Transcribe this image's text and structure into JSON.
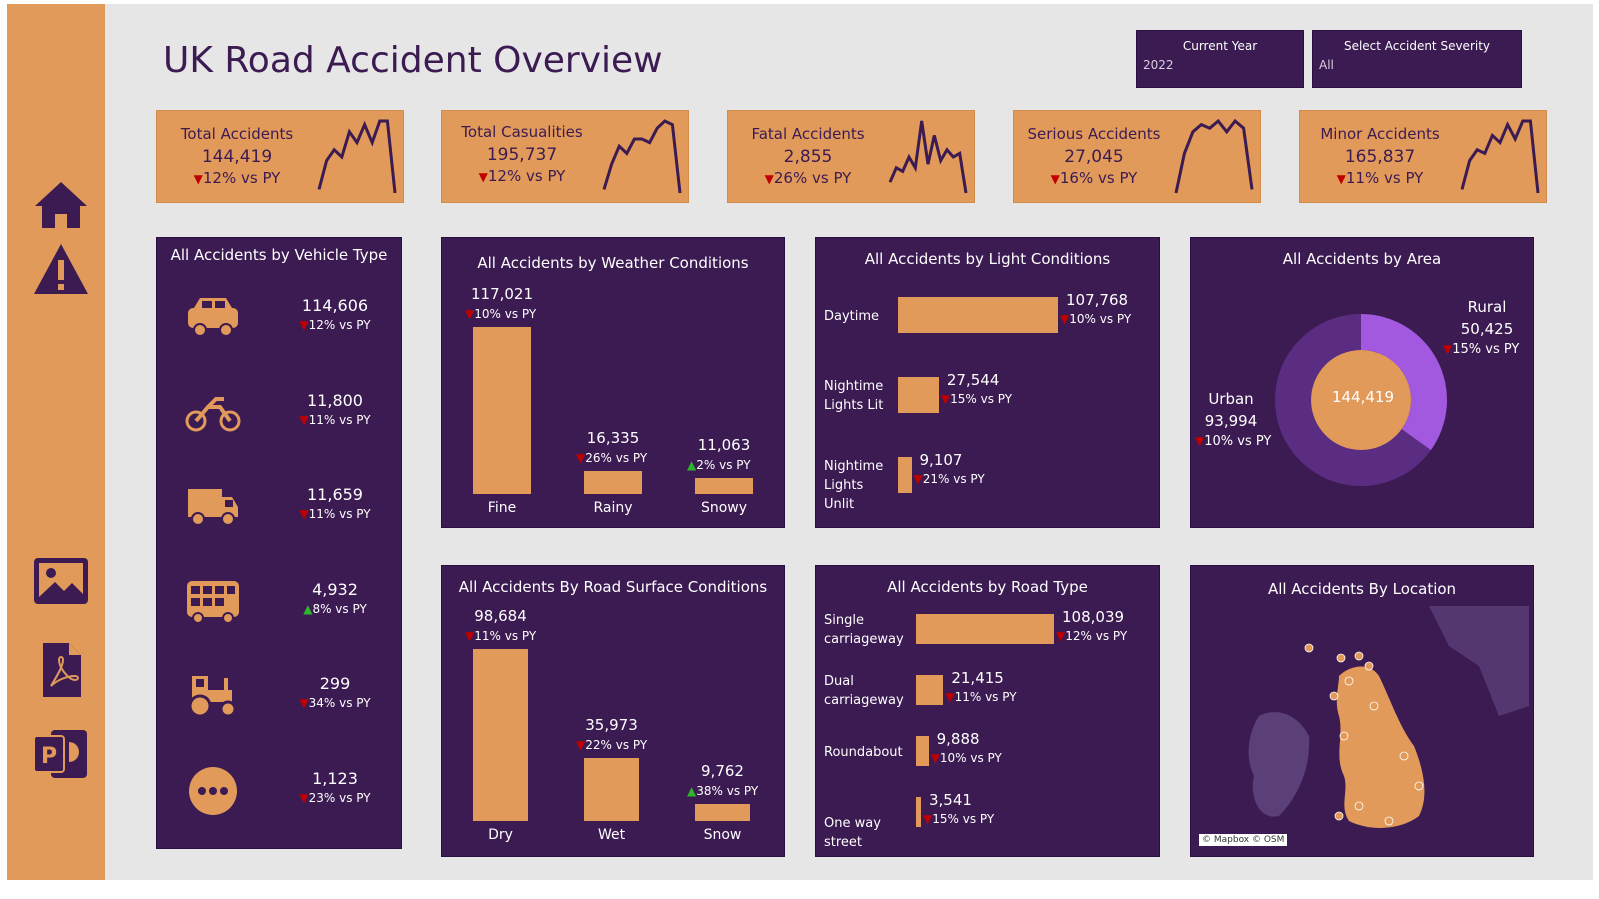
{
  "title": "UK Road Accident Overview",
  "filters": {
    "year": {
      "label": "Current Year",
      "value": "2022"
    },
    "severity": {
      "label": "Select Accident Severity",
      "value": "All"
    }
  },
  "colors": {
    "accent": "#e19a5a",
    "panel": "#3b1b52",
    "down": "#c00000",
    "up": "#2db52d",
    "rural": "#a259e0",
    "urban": "#5a2d82"
  },
  "sidebar": {
    "icons": [
      "home-icon",
      "warning-icon",
      "image-icon",
      "pdf-icon",
      "powerpoint-icon"
    ]
  },
  "kpis": [
    {
      "title": "Total Accidents",
      "value": "144,419",
      "delta": "12% vs PY",
      "trend": [
        0.05,
        0.45,
        0.6,
        0.5,
        0.85,
        0.7,
        0.95,
        0.7,
        1.0,
        1.0,
        0.0
      ]
    },
    {
      "title": "Total Casualities",
      "value": "195,737",
      "delta": "12% vs PY",
      "trend": [
        0.05,
        0.4,
        0.65,
        0.55,
        0.75,
        0.75,
        0.7,
        0.9,
        1.0,
        0.95,
        0.0
      ]
    },
    {
      "title": "Fatal Accidents",
      "value": "2,855",
      "delta": "26% vs PY",
      "trend": [
        0.15,
        0.35,
        0.3,
        0.5,
        0.35,
        1.0,
        0.4,
        0.8,
        0.45,
        0.6,
        0.5,
        0.55,
        0.0
      ]
    },
    {
      "title": "Serious Accidents",
      "value": "27,045",
      "delta": "16% vs PY",
      "trend": [
        0.0,
        0.55,
        0.85,
        0.95,
        0.9,
        1.0,
        0.85,
        1.0,
        0.9,
        0.05
      ]
    },
    {
      "title": "Minor Accidents",
      "value": "165,837",
      "delta": "11% vs PY",
      "trend": [
        0.05,
        0.45,
        0.6,
        0.55,
        0.8,
        0.7,
        0.95,
        0.75,
        1.0,
        1.0,
        0.0
      ]
    }
  ],
  "vehicle": {
    "title": "All Accidents by Vehicle Type",
    "items": [
      {
        "icon": "car-icon",
        "value": "114,606",
        "delta": "12% vs PY",
        "dir": "down"
      },
      {
        "icon": "motorcycle-icon",
        "value": "11,800",
        "delta": "11% vs PY",
        "dir": "down"
      },
      {
        "icon": "van-icon",
        "value": "11,659",
        "delta": "11% vs PY",
        "dir": "down"
      },
      {
        "icon": "bus-icon",
        "value": "4,932",
        "delta": "8% vs PY",
        "dir": "up"
      },
      {
        "icon": "tractor-icon",
        "value": "299",
        "delta": "34% vs PY",
        "dir": "down"
      },
      {
        "icon": "more-icon",
        "value": "1,123",
        "delta": "23% vs PY",
        "dir": "down"
      }
    ]
  },
  "weather": {
    "title": "All Accidents by Weather Conditions",
    "chart_data": {
      "type": "bar",
      "categories": [
        "Fine",
        "Rainy",
        "Snowy"
      ],
      "values": [
        117021,
        16335,
        11063
      ],
      "labels": [
        "117,021",
        "16,335",
        "11,063"
      ],
      "deltas": [
        "10% vs PY",
        "26% vs PY",
        "2% vs PY"
      ],
      "dirs": [
        "down",
        "down",
        "up"
      ]
    }
  },
  "light": {
    "title": "All Accidents by Light Conditions",
    "chart_data": {
      "type": "bar",
      "orientation": "horizontal",
      "categories": [
        "Daytime",
        "Nightime Lights Lit",
        "Nightime Lights Unlit"
      ],
      "values": [
        107768,
        27544,
        9107
      ],
      "labels": [
        "107,768",
        "27,544",
        "9,107"
      ],
      "deltas": [
        "10% vs PY",
        "15% vs PY",
        "21% vs PY"
      ],
      "dirs": [
        "down",
        "down",
        "down"
      ]
    }
  },
  "area": {
    "title": "All Accidents by Area",
    "center": "144,419",
    "chart_data": {
      "type": "pie",
      "categories": [
        "Rural",
        "Urban"
      ],
      "values": [
        50425,
        93994
      ],
      "labels": [
        "50,425",
        "93,994"
      ],
      "deltas": [
        "15% vs PY",
        "10% vs PY"
      ]
    }
  },
  "surface": {
    "title": "All Accidents By Road Surface Conditions",
    "chart_data": {
      "type": "bar",
      "categories": [
        "Dry",
        "Wet",
        "Snow"
      ],
      "values": [
        98684,
        35973,
        9762
      ],
      "labels": [
        "98,684",
        "35,973",
        "9,762"
      ],
      "deltas": [
        "11% vs PY",
        "22% vs PY",
        "38% vs PY"
      ],
      "dirs": [
        "down",
        "down",
        "up"
      ]
    }
  },
  "road": {
    "title": "All Accidents by Road Type",
    "chart_data": {
      "type": "bar",
      "orientation": "horizontal",
      "categories": [
        "Single carriageway",
        "Dual carriageway",
        "Roundabout",
        "One way street"
      ],
      "values": [
        108039,
        21415,
        9888,
        3541
      ],
      "labels": [
        "108,039",
        "21,415",
        "9,888",
        "3,541"
      ],
      "deltas": [
        "12% vs PY",
        "11% vs PY",
        "10% vs PY",
        "15% vs PY"
      ],
      "dirs": [
        "down",
        "down",
        "down",
        "down"
      ]
    }
  },
  "location": {
    "title": "All Accidents By Location",
    "attribution": "© Mapbox © OSM"
  }
}
